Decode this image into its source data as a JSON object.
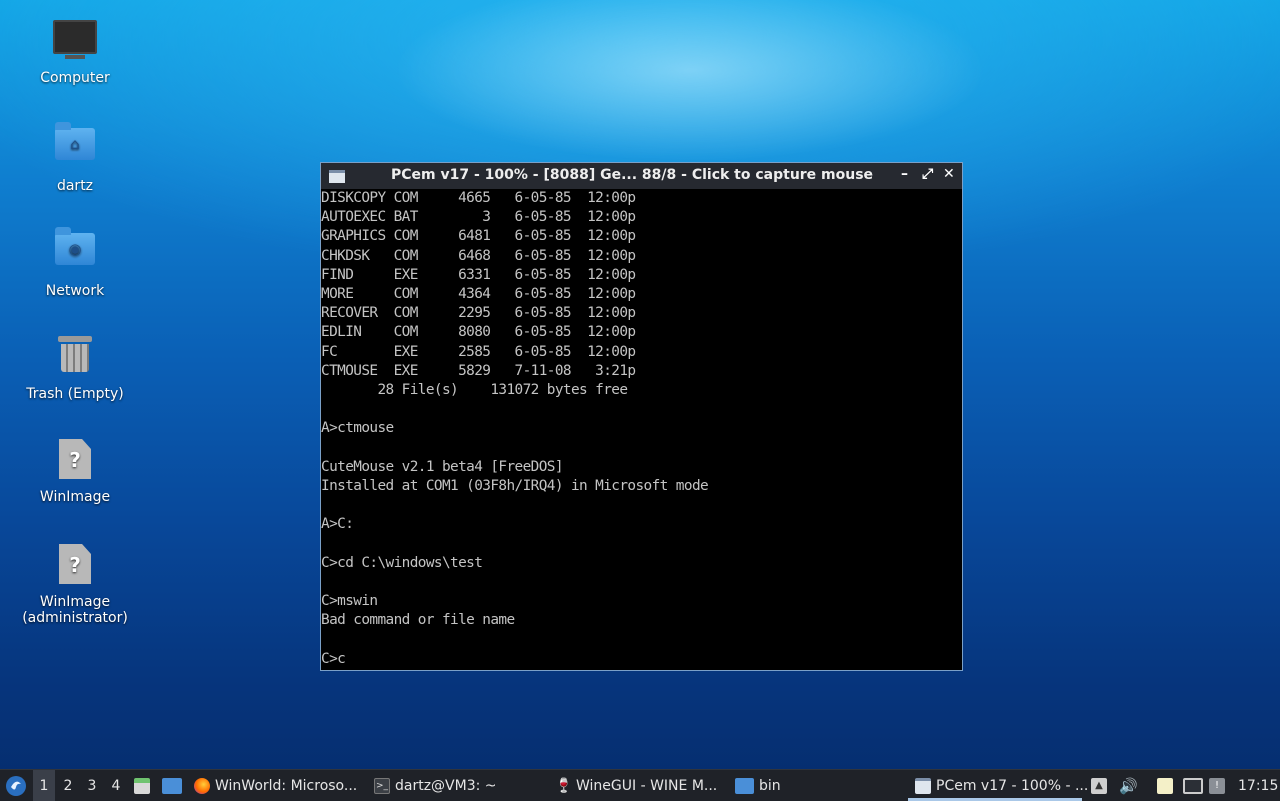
{
  "desktop": {
    "icons": [
      {
        "label": "Computer",
        "icon": "computer-icon"
      },
      {
        "label": "dartz",
        "icon": "home-folder-icon"
      },
      {
        "label": "Network",
        "icon": "network-folder-icon"
      },
      {
        "label": "Trash (Empty)",
        "icon": "trash-icon"
      },
      {
        "label": "WinImage",
        "icon": "unknown-file-icon"
      },
      {
        "label": "WinImage\n(administrator)",
        "label_line1": "WinImage",
        "label_line2": "(administrator)",
        "icon": "unknown-file-icon"
      }
    ]
  },
  "window": {
    "title": "PCem v17 - 100% - [8088] Ge... 88/8 - Click to capture mouse",
    "controls": {
      "minimize": "–",
      "maximize": "⤢",
      "close": "✕"
    },
    "terminal_lines": [
      "DISKCOPY COM     4665   6-05-85  12:00p",
      "AUTOEXEC BAT        3   6-05-85  12:00p",
      "GRAPHICS COM     6481   6-05-85  12:00p",
      "CHKDSK   COM     6468   6-05-85  12:00p",
      "FIND     EXE     6331   6-05-85  12:00p",
      "MORE     COM     4364   6-05-85  12:00p",
      "RECOVER  COM     2295   6-05-85  12:00p",
      "EDLIN    COM     8080   6-05-85  12:00p",
      "FC       EXE     2585   6-05-85  12:00p",
      "CTMOUSE  EXE     5829   7-11-08   3:21p",
      "       28 File(s)    131072 bytes free",
      "",
      "A>ctmouse",
      "",
      "CuteMouse v2.1 beta4 [FreeDOS]",
      "Installed at COM1 (03F8h/IRQ4) in Microsoft mode",
      "",
      "A>C:",
      "",
      "C>cd C:\\windows\\test",
      "",
      "C>mswin",
      "Bad command or file name",
      "",
      "C>c"
    ]
  },
  "taskbar": {
    "workspaces": [
      "1",
      "2",
      "3",
      "4"
    ],
    "active_workspace": "1",
    "tasks": [
      {
        "label": "WinWorld: Microso...",
        "icon": "firefox-icon"
      },
      {
        "label": "dartz@VM3: ~",
        "icon": "terminal-icon"
      },
      {
        "label": "WineGUI - WINE M...",
        "icon": "wine-icon"
      },
      {
        "label": "bin",
        "icon": "folder-icon"
      },
      {
        "label": "PCem v17 - 100% - ...",
        "icon": "pcem-icon"
      }
    ],
    "clock": "17:15",
    "colors": {
      "accent": "#aac8e8",
      "taskbar_bg": "#1f2228"
    }
  }
}
